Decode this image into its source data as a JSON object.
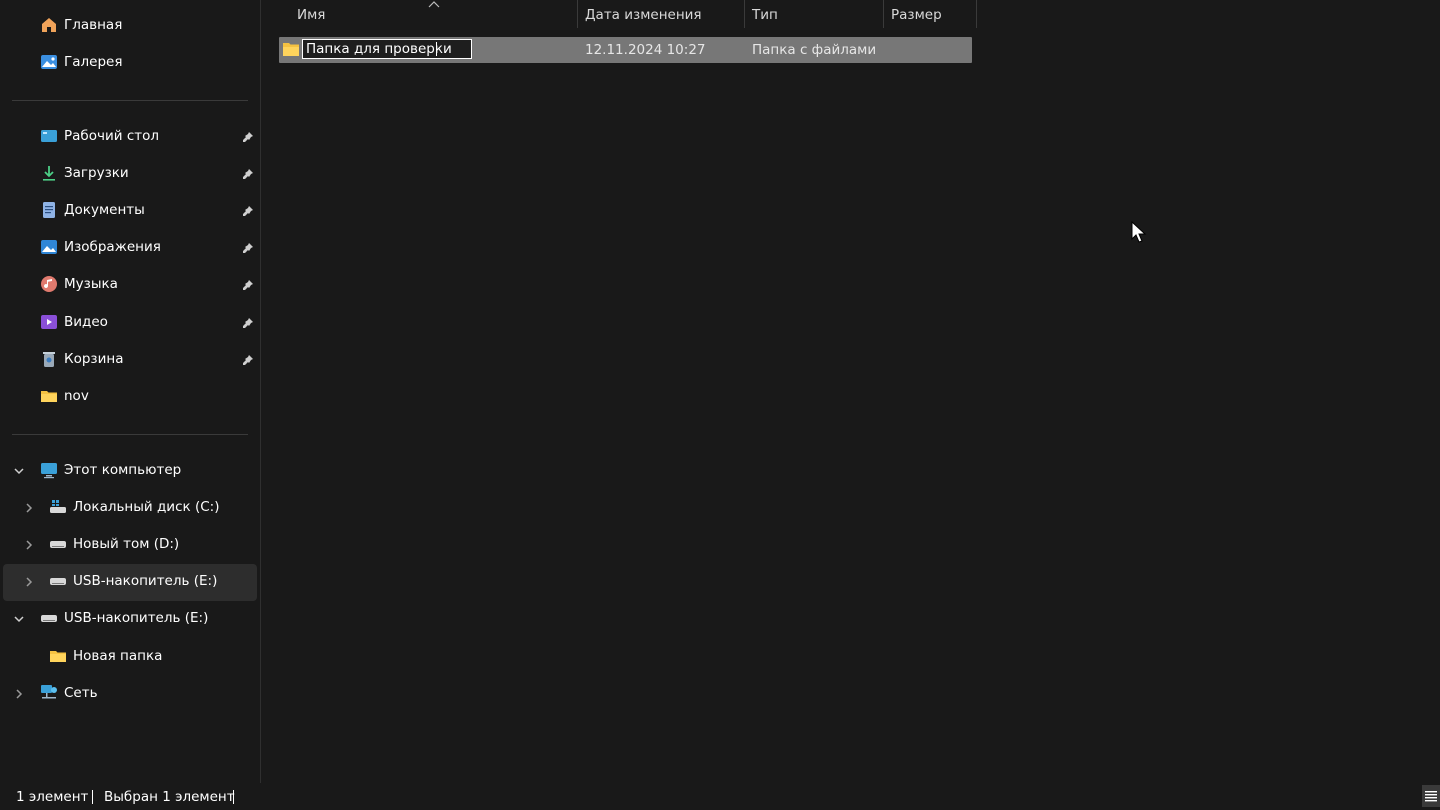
{
  "sidebar": {
    "top_items": [
      {
        "label": "Главная",
        "icon": "home-icon"
      },
      {
        "label": "Галерея",
        "icon": "gallery-icon"
      }
    ],
    "quick_access": [
      {
        "label": "Рабочий стол",
        "icon": "desktop-icon",
        "pinned": true
      },
      {
        "label": "Загрузки",
        "icon": "downloads-icon",
        "pinned": true
      },
      {
        "label": "Документы",
        "icon": "documents-icon",
        "pinned": true
      },
      {
        "label": "Изображения",
        "icon": "pictures-icon",
        "pinned": true
      },
      {
        "label": "Музыка",
        "icon": "music-icon",
        "pinned": true
      },
      {
        "label": "Видео",
        "icon": "videos-icon",
        "pinned": true
      },
      {
        "label": "Корзина",
        "icon": "recycle-bin-icon",
        "pinned": true
      },
      {
        "label": "nov",
        "icon": "folder-icon",
        "pinned": false
      }
    ],
    "tree": {
      "this_pc": "Этот компьютер",
      "drive_c": "Локальный диск (C:)",
      "drive_d": "Новый том (D:)",
      "drive_e_child": "USB-накопитель (E:)",
      "drive_e": "USB-накопитель (E:)",
      "new_folder": "Новая папка",
      "network": "Сеть"
    }
  },
  "columns": {
    "name": "Имя",
    "date": "Дата изменения",
    "type": "Тип",
    "size": "Размер"
  },
  "rows": [
    {
      "name": "Папка для проверки",
      "date": "12.11.2024 10:27",
      "type": "Папка с файлами",
      "size": ""
    }
  ],
  "status": {
    "count": "1 элемент",
    "selected": "Выбран 1 элемент"
  },
  "colors": {
    "background": "#191919",
    "selection": "#777777",
    "folder": "#f5c242",
    "accent_blue": "#4aa3e8"
  }
}
